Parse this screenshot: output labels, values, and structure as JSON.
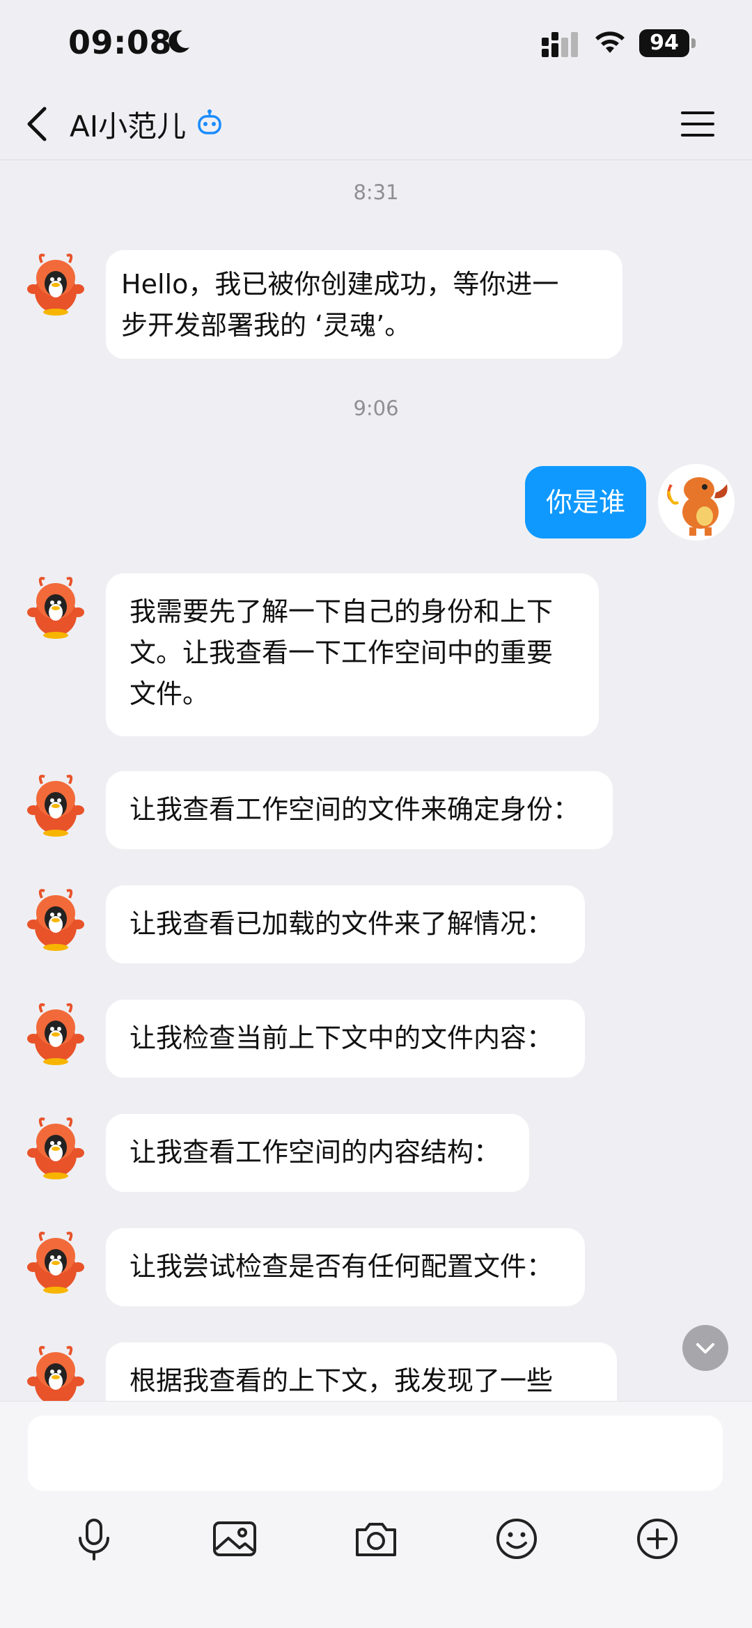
{
  "status_bar": {
    "time": "09:08",
    "battery": "94"
  },
  "nav": {
    "title": "AI小范儿",
    "icons": [
      "chevron-left-icon",
      "robot-icon",
      "hamburger-menu-icon"
    ]
  },
  "chat": {
    "messages": [
      {
        "type": "time",
        "text": "8:31"
      },
      {
        "type": "bot",
        "lines": [
          "Hello，我已被你创建成功，等你进一",
          "步开发部署我的 ‘灵魂’。"
        ]
      },
      {
        "type": "time",
        "text": "9:06"
      },
      {
        "type": "user",
        "text": "你是谁"
      },
      {
        "type": "bot",
        "lines": [
          "我需要先了解一下自己的身份和上下",
          "文。让我查看一下工作空间中的重要",
          "文件。"
        ]
      },
      {
        "type": "bot",
        "lines": [
          "让我查看工作空间的文件来确定身份："
        ]
      },
      {
        "type": "bot",
        "lines": [
          "让我查看已加载的文件来了解情况："
        ]
      },
      {
        "type": "bot",
        "lines": [
          "让我检查当前上下文中的文件内容："
        ]
      },
      {
        "type": "bot",
        "lines": [
          "让我查看工作空间的内容结构："
        ]
      },
      {
        "type": "bot",
        "lines": [
          "让我尝试检查是否有任何配置文件："
        ]
      },
      {
        "type": "bot",
        "lines": [
          "根据我查看的上下文，我发现了一些"
        ]
      }
    ]
  },
  "input": {
    "placeholder": ""
  },
  "toolbar": {
    "icons": [
      "microphone-icon",
      "image-icon",
      "camera-icon",
      "emoji-icon",
      "plus-icon"
    ]
  },
  "colors": {
    "background": "#efeff3",
    "user_bubble": "#0f99ff",
    "bot_bubble": "#ffffff",
    "timestamp": "#8e8e93"
  }
}
